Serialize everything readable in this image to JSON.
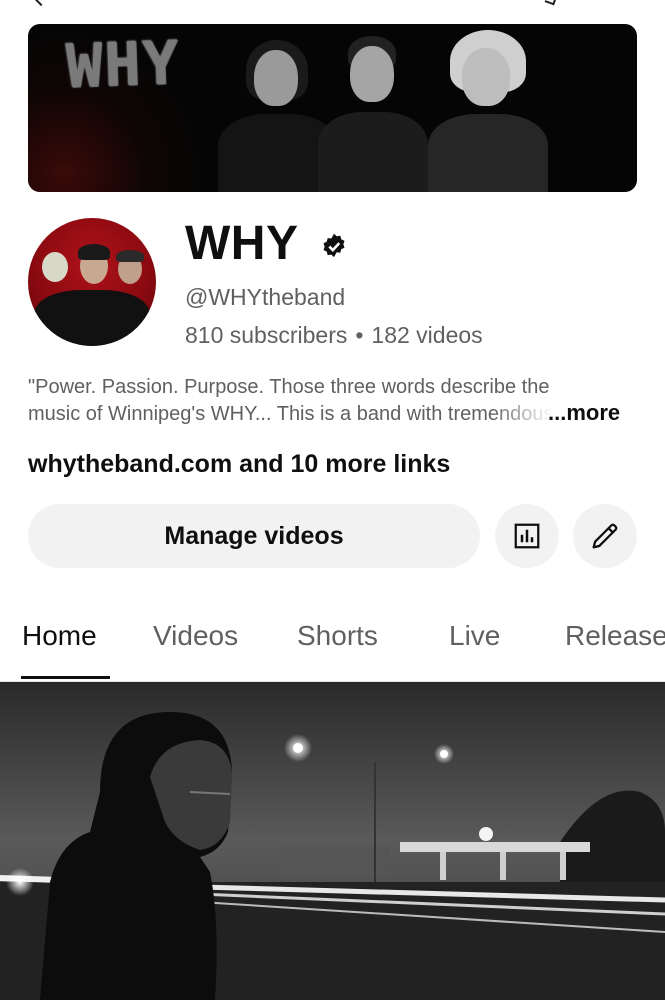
{
  "banner": {
    "logo_text": "WHY"
  },
  "channel": {
    "name": "WHY",
    "handle": "@WHYtheband",
    "subscribers": "810 subscribers",
    "separator": "•",
    "videos": "182 videos",
    "description_line1": "\"Power. Passion. Purpose. Those three words describe the",
    "description_line2": "music of Winnipeg's WHY... This is a band with tremendous",
    "more_label": "...more",
    "links": "whytheband.com and 10 more links"
  },
  "actions": {
    "manage_label": "Manage videos",
    "analytics_icon": "analytics-icon",
    "edit_icon": "pencil-icon"
  },
  "tabs": [
    {
      "label": "Home",
      "active": true
    },
    {
      "label": "Videos",
      "active": false
    },
    {
      "label": "Shorts",
      "active": false
    },
    {
      "label": "Live",
      "active": false
    },
    {
      "label": "Releases",
      "active": false
    }
  ],
  "colors": {
    "text_primary": "#0f0f0f",
    "text_secondary": "#606060",
    "button_bg": "#f2f2f2",
    "avatar_red": "#b0121a"
  }
}
